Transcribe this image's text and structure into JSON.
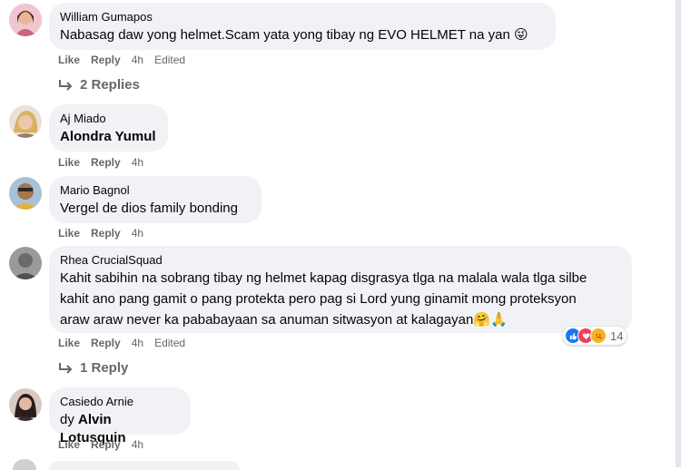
{
  "comments": [
    {
      "author": "William Gumapos",
      "text": "Nabasag daw yong helmet.Scam yata yong tibay ng EVO HELMET na yan 😜",
      "like": "Like",
      "reply": "Reply",
      "time": "4h",
      "edited": "Edited",
      "replies_label": "2 Replies",
      "avatar_color": "#e8a3b0"
    },
    {
      "author": "Aj Miado",
      "mention": "Alondra Yumul",
      "like": "Like",
      "reply": "Reply",
      "time": "4h",
      "avatar_color": "#d8c7b4"
    },
    {
      "author": "Mario Bagnol",
      "text": "Vergel de dios family bonding",
      "like": "Like",
      "reply": "Reply",
      "time": "4h",
      "avatar_color": "#c9a56a"
    },
    {
      "author": "Rhea CrucialSquad",
      "text_lines": [
        "Kahit sabihin na sobrang tibay ng helmet kapag disgrasya tlga na malala wala tlga silbe",
        "kahit ano pang gamit o pang protekta pero pag si Lord yung ginamit mong proteksyon",
        "araw araw never ka pababayaan sa anuman sitwasyon at kalagayan🤗🙏"
      ],
      "like": "Like",
      "reply": "Reply",
      "time": "4h",
      "edited": "Edited",
      "reaction_count": "14",
      "reactions": [
        "like",
        "love",
        "care"
      ],
      "replies_label": "1 Reply",
      "avatar_color": "#8b8b8b"
    },
    {
      "author": "Casiedo Arnie",
      "prefix": "dy",
      "mention": "Alvin Lotusquin",
      "like": "Like",
      "reply": "Reply",
      "time": "4h",
      "avatar_color": "#b58a7c"
    }
  ],
  "colors": {
    "bubble": "#f0f2f5",
    "meta": "#65676b",
    "like_reaction": "#1877f2",
    "love_reaction": "#f33e58",
    "care_reaction": "#f7b125"
  }
}
